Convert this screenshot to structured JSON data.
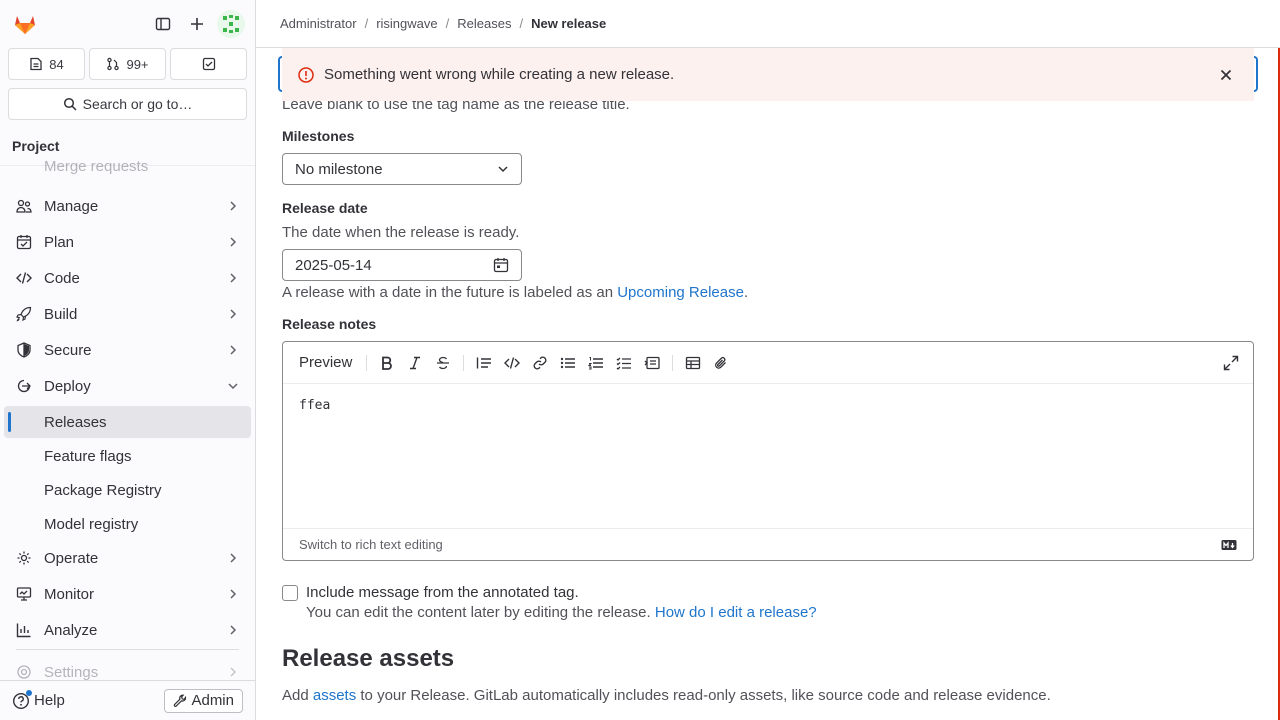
{
  "sidebar": {
    "counts": {
      "issues": "84",
      "merge_requests": "99+"
    },
    "search_label": "Search or go to…",
    "section_title": "Project",
    "faded_top_item": "Merge requests",
    "items": [
      {
        "label": "Manage"
      },
      {
        "label": "Plan"
      },
      {
        "label": "Code"
      },
      {
        "label": "Build"
      },
      {
        "label": "Secure"
      },
      {
        "label": "Deploy"
      }
    ],
    "deploy_subitems": [
      {
        "label": "Releases"
      },
      {
        "label": "Feature flags"
      },
      {
        "label": "Package Registry"
      },
      {
        "label": "Model registry"
      }
    ],
    "items_after": [
      {
        "label": "Operate"
      },
      {
        "label": "Monitor"
      },
      {
        "label": "Analyze"
      }
    ],
    "faded_bottom_item": "Settings",
    "help_label": "Help",
    "admin_label": "Admin"
  },
  "breadcrumb": [
    "Administrator",
    "risingwave",
    "Releases",
    "New release"
  ],
  "alert": {
    "message": "Something went wrong while creating a new release."
  },
  "form": {
    "title_help": "Leave blank to use the tag name as the release title.",
    "milestones_label": "Milestones",
    "milestone_value": "No milestone",
    "release_date_label": "Release date",
    "release_date_help": "The date when the release is ready.",
    "release_date_value": "2025-05-14",
    "future_note_prefix": "A release with a date in the future is labeled as an ",
    "future_note_link": "Upcoming Release",
    "future_note_suffix": ".",
    "notes_label": "Release notes",
    "editor": {
      "preview_label": "Preview",
      "content": "ffea",
      "switch_label": "Switch to rich text editing"
    },
    "include_tag_label": "Include message from the annotated tag.",
    "include_tag_help": "You can edit the content later by editing the release. ",
    "include_tag_link": "How do I edit a release?",
    "assets_heading": "Release assets",
    "assets_text_prefix": "Add ",
    "assets_link": "assets",
    "assets_text_suffix": " to your Release. GitLab automatically includes read-only assets, like source code and release evidence."
  },
  "colors": {
    "accent": "#1f75cb",
    "danger": "#dd2b0e",
    "alert_bg": "#fcf1ef"
  }
}
